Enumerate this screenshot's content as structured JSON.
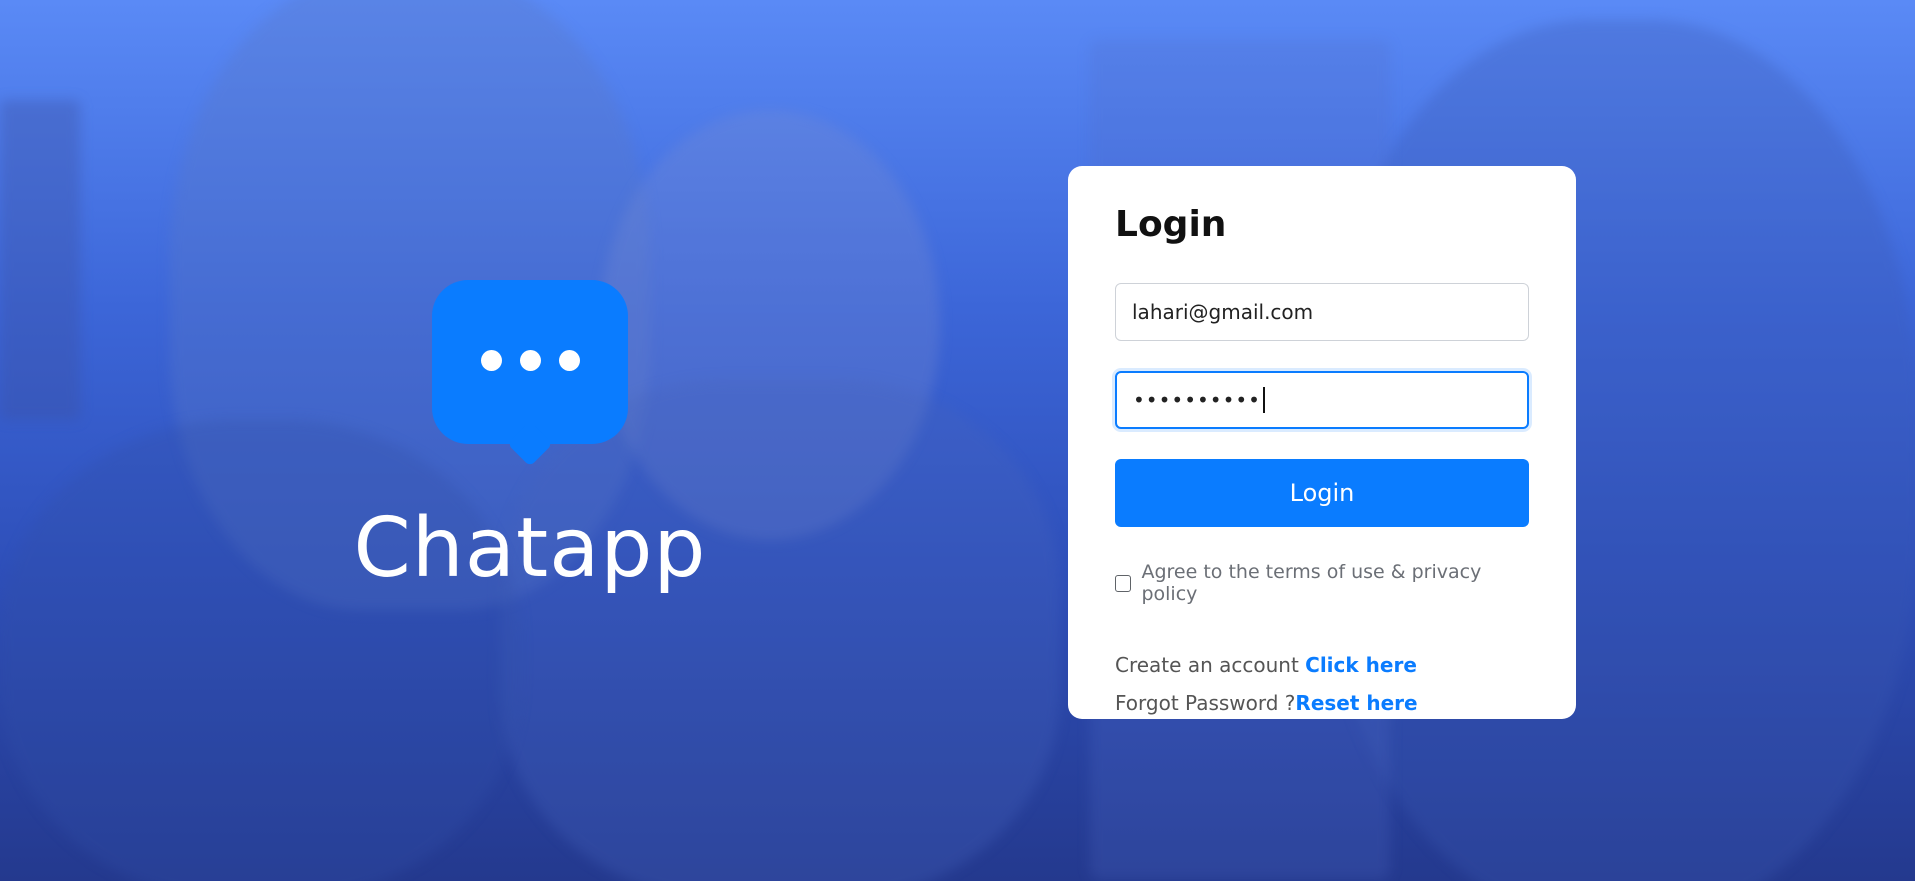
{
  "brand": {
    "name": "Chatapp",
    "icon": "chat-bubble-icon"
  },
  "login": {
    "title": "Login",
    "email_value": "lahari@gmail.com",
    "password_masked": "••••••••••",
    "submit_label": "Login",
    "terms_label": "Agree to the terms of use & privacy policy",
    "terms_checked": false,
    "create_account_text": "Create an account ",
    "create_account_link": "Click here",
    "forgot_text": "Forgot Password ?",
    "forgot_link": "Reset here"
  },
  "colors": {
    "accent": "#0a7cff",
    "background_top": "#5a8af6",
    "background_bottom": "#24398e",
    "card": "#ffffff"
  }
}
